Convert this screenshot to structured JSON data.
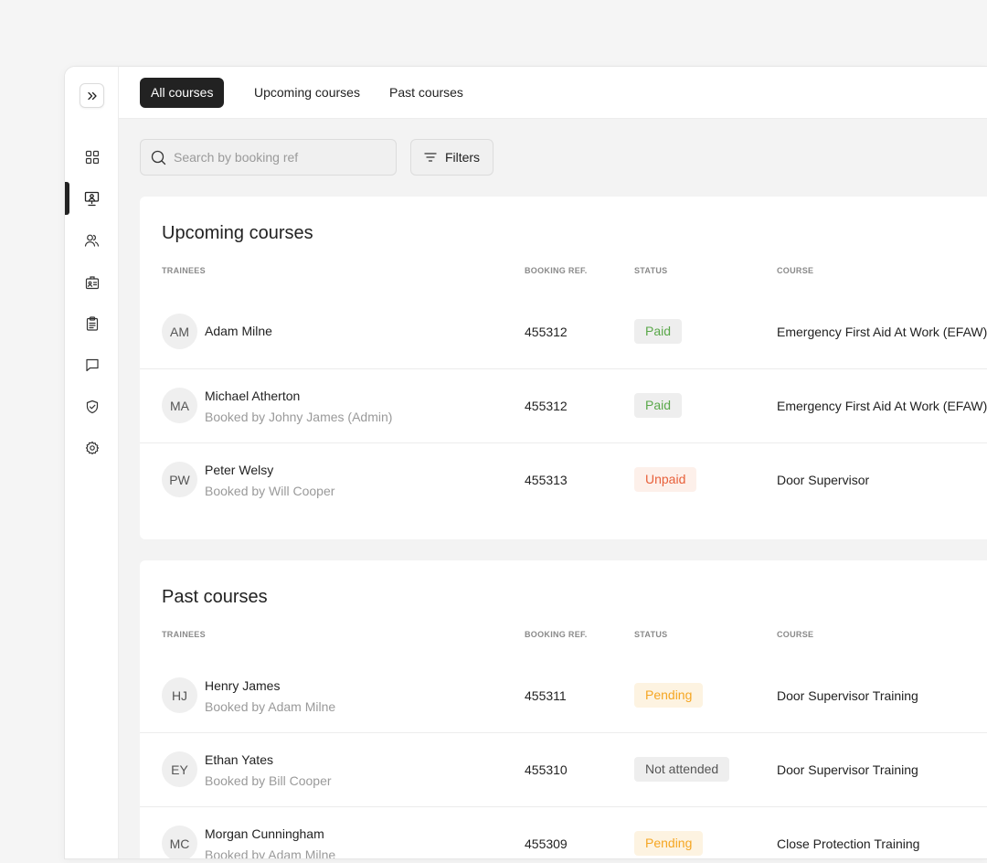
{
  "tabs": [
    {
      "label": "All courses",
      "active": true
    },
    {
      "label": "Upcoming courses",
      "active": false
    },
    {
      "label": "Past courses",
      "active": false
    }
  ],
  "sidebar": {
    "items": [
      {
        "icon": "dashboard-icon",
        "active": false
      },
      {
        "icon": "courses-icon",
        "active": true
      },
      {
        "icon": "users-icon",
        "active": false
      },
      {
        "icon": "id-badge-icon",
        "active": false
      },
      {
        "icon": "clipboard-icon",
        "active": false
      },
      {
        "icon": "chat-icon",
        "active": false
      },
      {
        "icon": "shield-icon",
        "active": false
      },
      {
        "icon": "gear-icon",
        "active": false
      }
    ]
  },
  "search": {
    "placeholder": "Search by booking ref"
  },
  "filters": {
    "label": "Filters"
  },
  "columns": {
    "trainees": "TRAINEES",
    "booking_ref": "BOOKING REF.",
    "status": "STATUS",
    "course": "COURSE"
  },
  "colors": {
    "accent": "#222222",
    "paid_text": "#5aa84a",
    "paid_bg": "#eeeeee",
    "unpaid_text": "#e8603a",
    "unpaid_bg": "#fdf0ea",
    "pending_text": "#f5a623",
    "pending_bg": "#fdf3e1",
    "not_attended_text": "#555555",
    "not_attended_bg": "#eeeeee"
  },
  "upcoming": {
    "title": "Upcoming courses",
    "rows": [
      {
        "initials": "AM",
        "name": "Adam Milne",
        "booked_by": "",
        "ref": "455312",
        "status": "Paid",
        "status_kind": "paid",
        "course": "Emergency First Aid At Work (EFAW)"
      },
      {
        "initials": "MA",
        "name": "Michael Atherton",
        "booked_by": "Booked by Johny James (Admin)",
        "ref": "455312",
        "status": "Paid",
        "status_kind": "paid",
        "course": "Emergency First Aid At Work (EFAW)"
      },
      {
        "initials": "PW",
        "name": "Peter Welsy",
        "booked_by": "Booked by Will Cooper",
        "ref": "455313",
        "status": "Unpaid",
        "status_kind": "unpaid",
        "course": "Door Supervisor"
      }
    ]
  },
  "past": {
    "title": "Past courses",
    "rows": [
      {
        "initials": "HJ",
        "name": "Henry James",
        "booked_by": "Booked by Adam Milne",
        "ref": "455311",
        "status": "Pending",
        "status_kind": "pending",
        "course": "Door Supervisor Training"
      },
      {
        "initials": "EY",
        "name": "Ethan Yates",
        "booked_by": "Booked by Bill Cooper",
        "ref": "455310",
        "status": "Not attended",
        "status_kind": "not_attended",
        "course": "Door Supervisor Training"
      },
      {
        "initials": "MC",
        "name": "Morgan Cunningham",
        "booked_by": "Booked by Adam Milne",
        "ref": "455309",
        "status": "Pending",
        "status_kind": "pending",
        "course": "Close Protection Training"
      }
    ]
  }
}
